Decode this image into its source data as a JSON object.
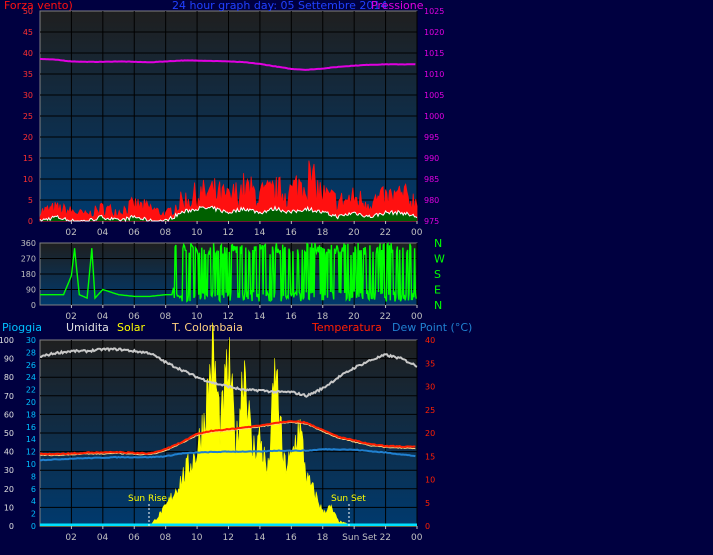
{
  "colors": {
    "background": "#000040",
    "plot_top": "#1f1f1f",
    "plot_bottom": "#003a6e",
    "grid": "#000000",
    "wind_gust": "#ff1010",
    "wind_avg": "#ffffff",
    "wind_dark": "#006000",
    "pressure": "#e000e0",
    "direction": "#00ff00",
    "rain": "#00e0ff",
    "humidity": "#c8c8c8",
    "solar": "#ffff00",
    "temperature": "#ff2000",
    "temp_colombaia": "#ffd080",
    "dew_point": "#2080d0",
    "tick_text": "#c0c0c0",
    "compass_text": "#00ff00"
  },
  "chart_data": [
    {
      "type": "line",
      "name_key": "wind_pressure",
      "title": "24 hour graph day:  05 Settembre 2014",
      "left_axis_label": "Forza vento)",
      "right_axis_label": "Pressione",
      "x_tick_labels": [
        "02",
        "04",
        "06",
        "08",
        "10",
        "12",
        "14",
        "16",
        "18",
        "20",
        "22",
        "00"
      ],
      "x_range_hours": [
        0,
        24
      ],
      "ylim_left": [
        0,
        50
      ],
      "y_ticks_left": [
        "0",
        "5",
        "10",
        "15",
        "20",
        "25",
        "30",
        "35",
        "40",
        "45",
        "50"
      ],
      "ylim_right": [
        975,
        1025
      ],
      "y_ticks_right": [
        "975",
        "980",
        "985",
        "990",
        "995",
        "1000",
        "1005",
        "1010",
        "1015",
        "1020",
        "1025"
      ],
      "series": [
        {
          "key": "pressure",
          "axis": "right",
          "x": [
            0,
            1,
            2,
            3,
            4,
            5,
            6,
            7,
            8,
            9,
            10,
            11,
            12,
            13,
            14,
            15,
            16,
            17,
            18,
            19,
            20,
            21,
            22,
            23,
            24
          ],
          "values": [
            1013.6,
            1013.4,
            1013.0,
            1012.9,
            1012.9,
            1013.0,
            1012.9,
            1012.8,
            1013.0,
            1013.2,
            1013.2,
            1013.1,
            1013.0,
            1012.8,
            1012.4,
            1011.8,
            1011.2,
            1011.0,
            1011.3,
            1011.7,
            1012.0,
            1012.2,
            1012.3,
            1012.3,
            1012.3
          ]
        },
        {
          "key": "wind_gust",
          "axis": "left",
          "x": [
            0,
            1,
            2,
            3,
            4,
            5,
            6,
            7,
            8,
            9,
            10,
            11,
            12,
            13,
            14,
            15,
            16,
            17,
            18,
            19,
            20,
            21,
            22,
            23,
            24
          ],
          "values": [
            3,
            4,
            3,
            2,
            4,
            3,
            5,
            4,
            2,
            6,
            8,
            9,
            7,
            10,
            8,
            9,
            9,
            14,
            8,
            6,
            7,
            6,
            7,
            8,
            6
          ]
        },
        {
          "key": "wind_avg",
          "axis": "left",
          "x": [
            0,
            1,
            2,
            3,
            4,
            5,
            6,
            7,
            8,
            9,
            10,
            11,
            12,
            13,
            14,
            15,
            16,
            17,
            18,
            19,
            20,
            21,
            22,
            23,
            24
          ],
          "values": [
            0,
            1,
            0,
            0,
            1,
            0,
            1,
            0,
            0,
            2,
            3,
            3,
            2,
            3,
            2,
            3,
            2,
            3,
            2,
            1,
            2,
            1,
            2,
            2,
            1
          ]
        }
      ]
    },
    {
      "type": "line",
      "name_key": "wind_direction",
      "x_tick_labels": [
        "02",
        "04",
        "06",
        "08",
        "10",
        "12",
        "14",
        "16",
        "18",
        "20",
        "22",
        "00"
      ],
      "ylim": [
        0,
        360
      ],
      "y_ticks": [
        "0",
        "90",
        "180",
        "270",
        "360"
      ],
      "compass_labels": [
        "N",
        "W",
        "S",
        "E",
        "N"
      ],
      "series": [
        {
          "key": "direction",
          "x": [
            0,
            1.5,
            2,
            2.2,
            2.5,
            3,
            3.3,
            3.5,
            4,
            5,
            6,
            7,
            8,
            8.4,
            9,
            10,
            11,
            12,
            13,
            14,
            15,
            16,
            17,
            18,
            19,
            20,
            21,
            22,
            23,
            24
          ],
          "values": [
            60,
            60,
            170,
            330,
            60,
            40,
            330,
            40,
            90,
            60,
            50,
            50,
            60,
            60,
            300,
            30,
            330,
            30,
            300,
            30,
            330,
            40,
            300,
            30,
            340,
            50,
            330,
            40,
            340,
            30
          ]
        }
      ]
    },
    {
      "type": "line",
      "name_key": "rain_temp",
      "x_tick_labels": [
        "02",
        "04",
        "06",
        "08",
        "10",
        "12",
        "14",
        "16",
        "18",
        "Sun Set",
        "22",
        "00"
      ],
      "legend_labels": {
        "rain": "Pioggia",
        "humidity": "Umidita",
        "solar": "Solar",
        "colombaia": "T. Colombaia",
        "temperature": "Temperatura",
        "dew_point": "Dew Point (°C)"
      },
      "annotations": [
        "Sun Rise",
        "Sun Set"
      ],
      "ylim_humidity": [
        0,
        100
      ],
      "y_ticks_humidity": [
        "0",
        "10",
        "20",
        "30",
        "40",
        "50",
        "60",
        "70",
        "80",
        "90",
        "100"
      ],
      "ylim_rain": [
        0,
        30
      ],
      "y_ticks_rain": [
        "0",
        "2",
        "4",
        "6",
        "8",
        "10",
        "12",
        "14",
        "16",
        "18",
        "20",
        "22",
        "24",
        "26",
        "28",
        "30"
      ],
      "ylim_temp": [
        0,
        40
      ],
      "y_ticks_temp": [
        "0",
        "5",
        "10",
        "15",
        "20",
        "25",
        "30",
        "35",
        "40"
      ],
      "series": [
        {
          "key": "humidity",
          "axis": "humidity",
          "x": [
            0,
            1,
            2,
            3,
            4,
            5,
            6,
            7,
            8,
            9,
            10,
            11,
            12,
            13,
            14,
            15,
            16,
            17,
            18,
            19,
            20,
            21,
            22,
            23,
            24
          ],
          "values": [
            91,
            93,
            94,
            94,
            95,
            95,
            94,
            93,
            88,
            84,
            80,
            77,
            75,
            73,
            73,
            72,
            72,
            70,
            74,
            80,
            85,
            89,
            92,
            90,
            86
          ]
        },
        {
          "key": "temperature",
          "axis": "temp",
          "x": [
            0,
            1,
            2,
            3,
            4,
            5,
            6,
            7,
            8,
            9,
            10,
            11,
            12,
            13,
            14,
            15,
            16,
            17,
            18,
            19,
            20,
            21,
            22,
            23,
            24
          ],
          "values": [
            15.5,
            15.5,
            15.6,
            15.8,
            15.8,
            15.9,
            15.7,
            15.6,
            16.5,
            18,
            19.8,
            20.5,
            20.8,
            21.2,
            21.6,
            22.2,
            22.6,
            22.2,
            20.6,
            19.2,
            18.4,
            17.6,
            17.2,
            17.1,
            17.0
          ]
        },
        {
          "key": "dew_point",
          "axis": "temp",
          "x": [
            0,
            1,
            2,
            3,
            4,
            5,
            6,
            7,
            8,
            9,
            10,
            11,
            12,
            13,
            14,
            15,
            16,
            17,
            18,
            19,
            20,
            21,
            22,
            23,
            24
          ],
          "values": [
            14.2,
            14.3,
            14.5,
            14.6,
            14.7,
            14.8,
            14.8,
            14.8,
            15.0,
            15.6,
            15.8,
            15.9,
            16.0,
            16.0,
            16.0,
            16.2,
            16.2,
            16.2,
            16.5,
            16.5,
            16.4,
            16.1,
            15.8,
            15.4,
            15.0
          ]
        },
        {
          "key": "solar",
          "axis": "temp",
          "x": [
            0,
            7,
            8,
            9,
            10,
            10.5,
            11,
            11.5,
            12,
            12.5,
            13,
            13.5,
            14,
            14.5,
            15,
            15.5,
            16,
            16.5,
            17,
            17.5,
            18,
            18.5,
            19,
            20,
            24
          ],
          "values": [
            0,
            0,
            4,
            10,
            16,
            24,
            37,
            21,
            35,
            17,
            36,
            16,
            19,
            11,
            34,
            13,
            14,
            22,
            10,
            7,
            3,
            4,
            1,
            0,
            0
          ]
        },
        {
          "key": "rain",
          "axis": "rain",
          "x": [
            0,
            24
          ],
          "values": [
            0.2,
            0.2
          ]
        }
      ]
    }
  ]
}
